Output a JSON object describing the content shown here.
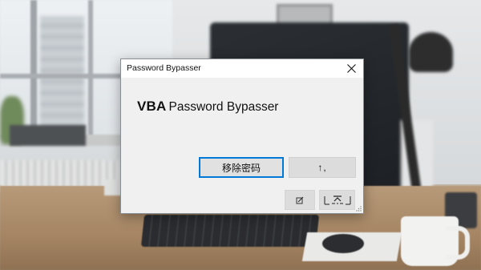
{
  "window": {
    "title": "Password Bypasser",
    "close_icon": "close-icon"
  },
  "heading": {
    "bold": "VBA",
    "rest": "Password Bypasser"
  },
  "buttons": {
    "remove_password": "移除密码",
    "upload": "↑,"
  },
  "small_buttons": [
    {
      "icon": "edit-icon"
    },
    {
      "icon": "expand-icon"
    }
  ],
  "colors": {
    "focus_border": "#0078d7",
    "dialog_bg": "#f0f0f0",
    "titlebar_bg": "#ffffff"
  }
}
